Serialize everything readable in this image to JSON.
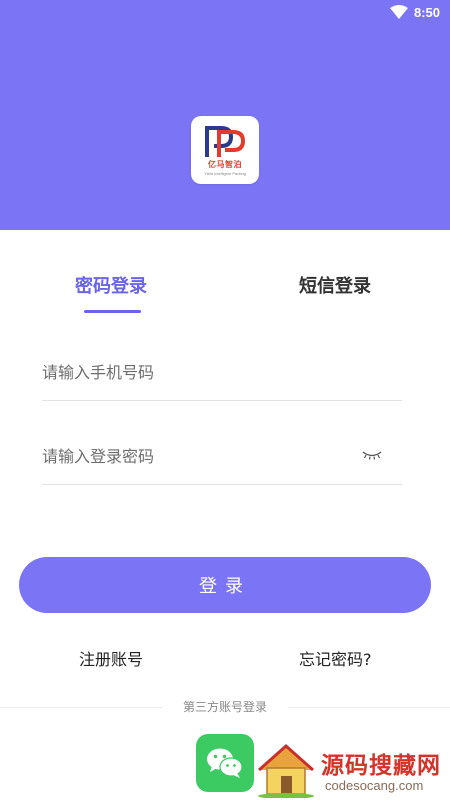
{
  "status_bar": {
    "time": "8:50",
    "wifi_icon": "wifi-icon"
  },
  "header": {
    "background_color": "#7b74f5",
    "logo": {
      "icon": "app-logo-icon",
      "brand_text": "亿马智泊",
      "sub_text": "YiMa Intelligent Parking"
    }
  },
  "tabs": [
    {
      "label": "密码登录",
      "active": true
    },
    {
      "label": "短信登录",
      "active": false
    }
  ],
  "form": {
    "phone": {
      "value": "",
      "placeholder": "请输入手机号码"
    },
    "password": {
      "value": "",
      "placeholder": "请输入登录密码",
      "toggle_icon": "eye-closed-icon"
    }
  },
  "login_button": {
    "label": "登录",
    "color": "#7b74f5"
  },
  "links": {
    "register": "注册账号",
    "forgot": "忘记密码?"
  },
  "third_party": {
    "label": "第三方账号登录",
    "wechat_icon": "wechat-icon",
    "wechat_color": "#3ccb62"
  },
  "watermark": {
    "title": "源码搜藏网",
    "url": "codesocang.com",
    "icon": "house-icon"
  },
  "colors": {
    "accent": "#6a64e8",
    "text_dark": "#333333",
    "divider": "#e3e3e3"
  }
}
